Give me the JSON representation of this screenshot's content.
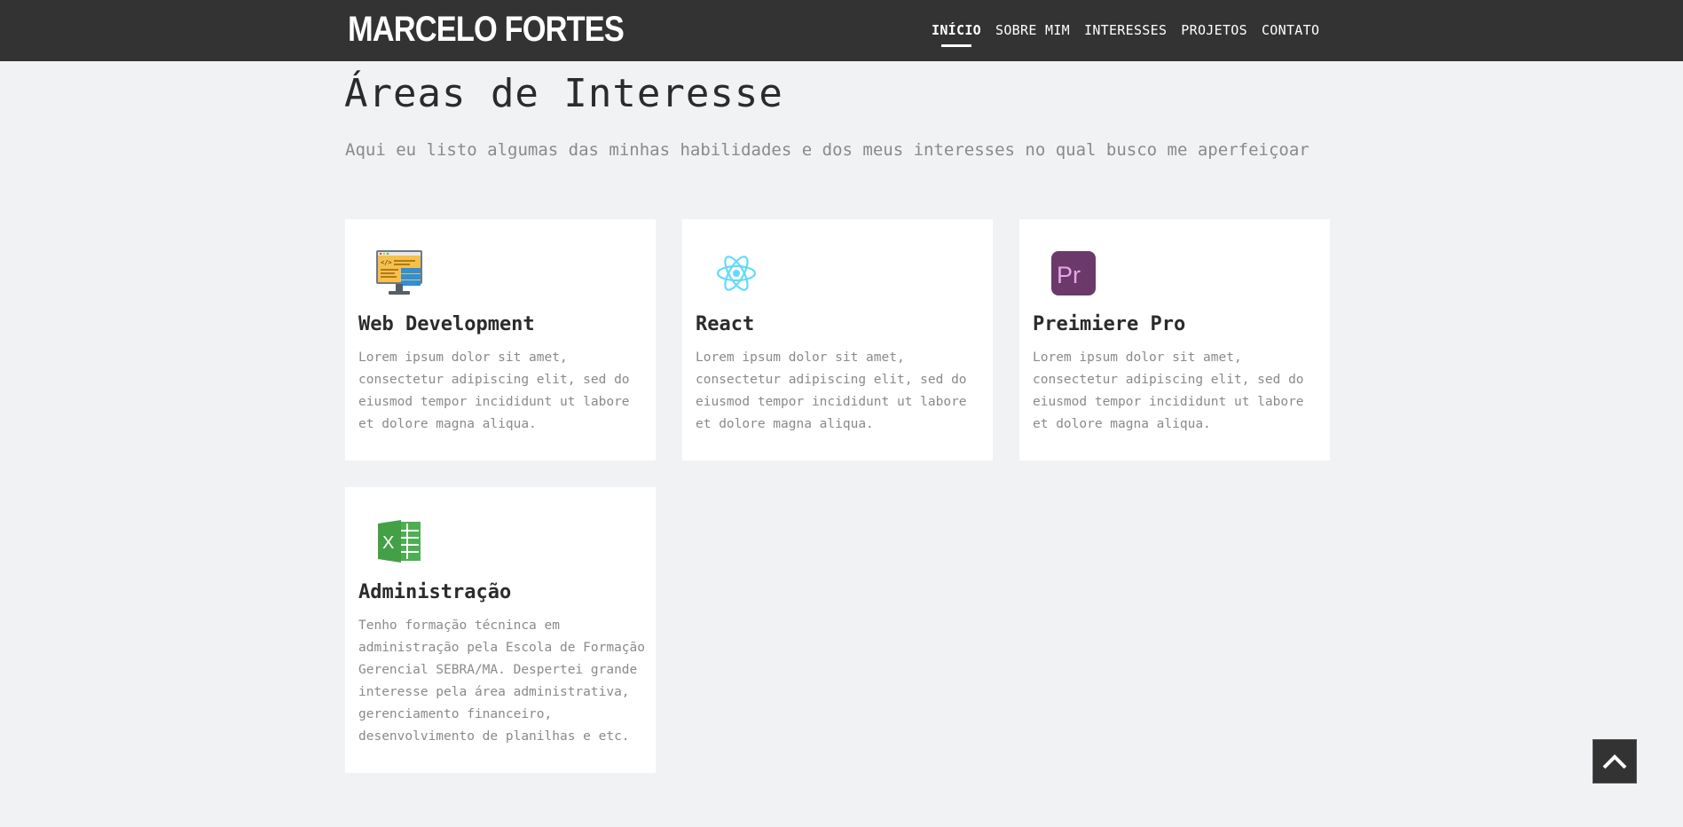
{
  "header": {
    "brand": "MARCELO FORTES",
    "nav": [
      {
        "label": "INÍCIO",
        "active": true
      },
      {
        "label": "SOBRE MIM",
        "active": false
      },
      {
        "label": "INTERESSES",
        "active": false
      },
      {
        "label": "PROJETOS",
        "active": false
      },
      {
        "label": "CONTATO",
        "active": false
      }
    ]
  },
  "section": {
    "title": "Áreas de Interesse",
    "subtitle": "Aqui eu listo algumas das minhas habilidades e dos meus interesses no qual busco me aperfeiçoar"
  },
  "cards": [
    {
      "icon": "web-development-icon",
      "title": "Web Development",
      "text": "Lorem ipsum dolor sit amet, consectetur adipiscing elit, sed do eiusmod tempor incididunt ut labore et dolore magna aliqua."
    },
    {
      "icon": "react-icon",
      "title": "React",
      "text": "Lorem ipsum dolor sit amet, consectetur adipiscing elit, sed do eiusmod tempor incididunt ut labore et dolore magna aliqua."
    },
    {
      "icon": "premiere-pro-icon",
      "title": "Preimiere Pro",
      "text": "Lorem ipsum dolor sit amet, consectetur adipiscing elit, sed do eiusmod tempor incididunt ut labore et dolore magna aliqua."
    },
    {
      "icon": "excel-icon",
      "title": "Administração",
      "text": "Tenho formação técninca em administração pela Escola de Formação Gerencial SEBRA/MA. Despertei grande interesse pela área administrativa, gerenciamento financeiro, desenvolvimento de planilhas e etc."
    }
  ],
  "colors": {
    "navbar": "#333333",
    "background": "#f1f2f4",
    "card": "#ffffff",
    "react": "#61dafb",
    "premiere": "#6b3a6b",
    "excel": "#4caf50"
  },
  "scroll_top": {
    "icon": "chevron-up-icon"
  }
}
